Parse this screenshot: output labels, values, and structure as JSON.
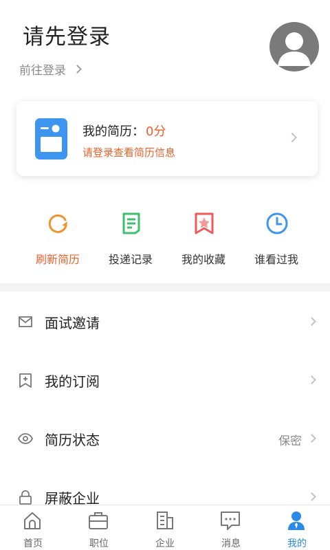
{
  "header": {
    "title": "请先登录",
    "goto_login": "前往登录"
  },
  "resume": {
    "title": "我的简历：",
    "score": "0分",
    "subtitle": "请登录查看简历信息"
  },
  "quick_actions": [
    {
      "label": "刷新简历",
      "icon": "refresh-icon",
      "color": "#f0932a"
    },
    {
      "label": "投递记录",
      "icon": "document-icon",
      "color": "#3cc06c"
    },
    {
      "label": "我的收藏",
      "icon": "bookmark-star-icon",
      "color": "#ee5a5a"
    },
    {
      "label": "谁看过我",
      "icon": "clock-icon",
      "color": "#3d95f0"
    }
  ],
  "menu": [
    {
      "label": "面试邀请",
      "icon": "mail-icon",
      "value": ""
    },
    {
      "label": "我的订阅",
      "icon": "bookmark-add-icon",
      "value": ""
    },
    {
      "label": "简历状态",
      "icon": "eye-icon",
      "value": "保密"
    },
    {
      "label": "屏蔽企业",
      "icon": "lock-icon",
      "value": ""
    }
  ],
  "tabs": [
    {
      "label": "首页",
      "icon": "home-icon"
    },
    {
      "label": "职位",
      "icon": "briefcase-icon"
    },
    {
      "label": "企业",
      "icon": "building-icon"
    },
    {
      "label": "消息",
      "icon": "message-icon"
    },
    {
      "label": "我的",
      "icon": "person-icon"
    }
  ],
  "colors": {
    "accent": "#f0602a",
    "active_tab": "#2a8ae8",
    "avatar_bg": "#7a7a7a"
  }
}
